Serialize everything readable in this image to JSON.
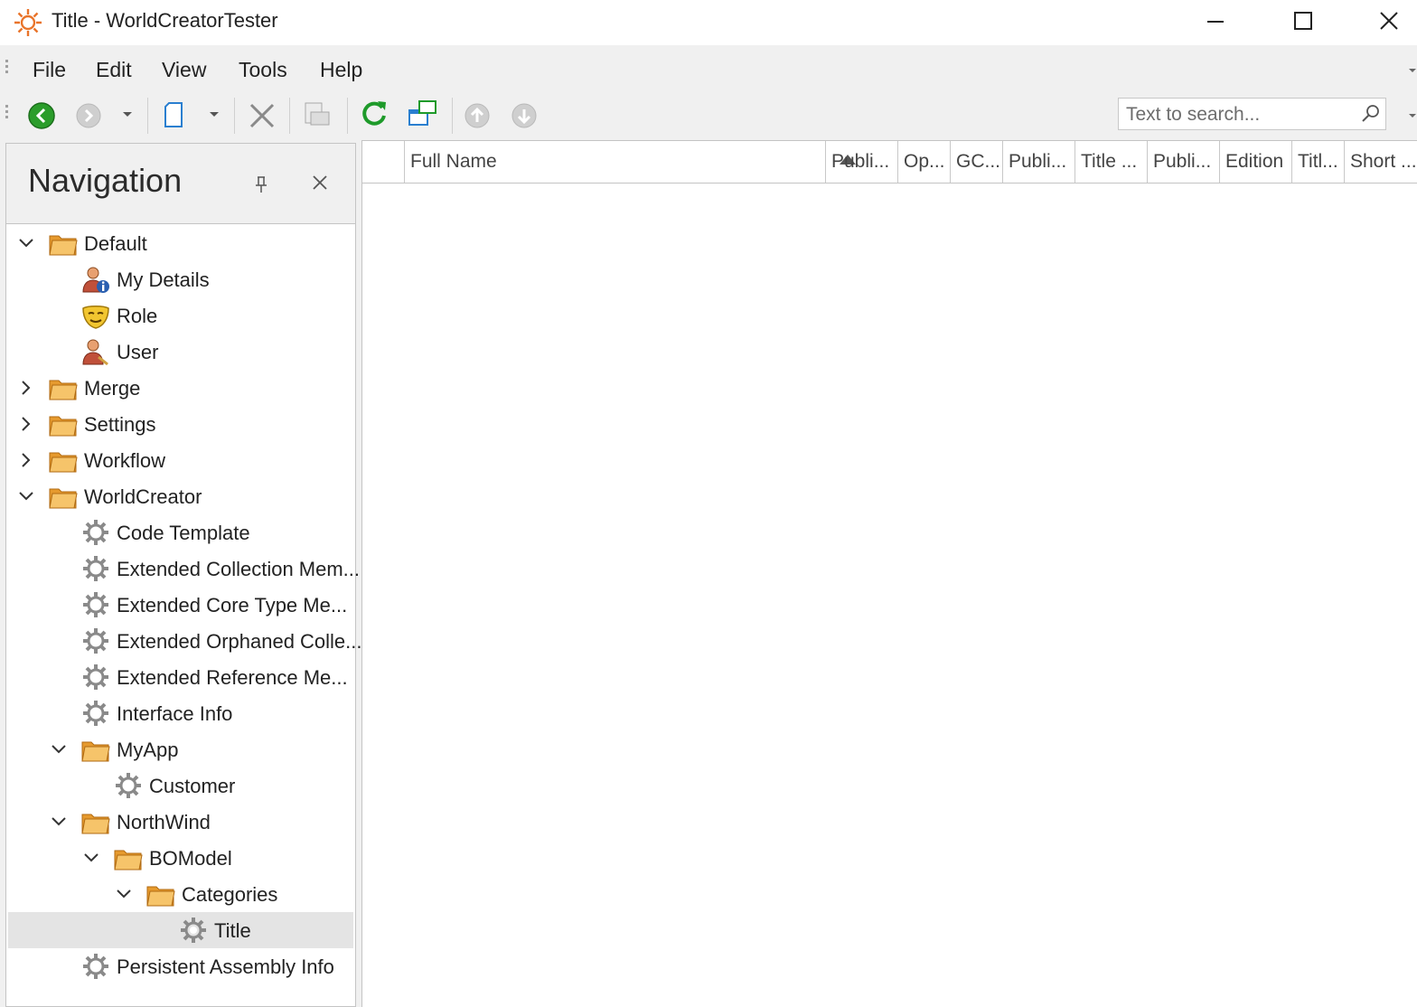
{
  "window": {
    "title": "Title - WorldCreatorTester"
  },
  "menu": [
    "File",
    "Edit",
    "View",
    "Tools",
    "Help"
  ],
  "search": {
    "placeholder": "Text to search..."
  },
  "navigation": {
    "title": "Navigation",
    "items": [
      {
        "label": "Default",
        "icon": "folder-icon",
        "expander": "expanded"
      },
      {
        "label": "My Details",
        "icon": "user-info-icon",
        "expander": "none"
      },
      {
        "label": "Role",
        "icon": "role-mask-icon",
        "expander": "none"
      },
      {
        "label": "User",
        "icon": "user-icon",
        "expander": "none"
      },
      {
        "label": "Merge",
        "icon": "folder-icon",
        "expander": "collapsed"
      },
      {
        "label": "Settings",
        "icon": "folder-icon",
        "expander": "collapsed"
      },
      {
        "label": "Workflow",
        "icon": "folder-icon",
        "expander": "collapsed"
      },
      {
        "label": "WorldCreator",
        "icon": "folder-icon",
        "expander": "expanded"
      },
      {
        "label": "Code Template",
        "icon": "gear-icon",
        "expander": "none"
      },
      {
        "label": "Extended Collection Mem...",
        "icon": "gear-icon",
        "expander": "none"
      },
      {
        "label": "Extended Core Type Me...",
        "icon": "gear-icon",
        "expander": "none"
      },
      {
        "label": "Extended Orphaned Colle...",
        "icon": "gear-icon",
        "expander": "none"
      },
      {
        "label": "Extended Reference Me...",
        "icon": "gear-icon",
        "expander": "none"
      },
      {
        "label": "Interface Info",
        "icon": "gear-icon",
        "expander": "none"
      },
      {
        "label": "MyApp",
        "icon": "folder-icon",
        "expander": "expanded"
      },
      {
        "label": "Customer",
        "icon": "gear-icon",
        "expander": "none"
      },
      {
        "label": "NorthWind",
        "icon": "folder-icon",
        "expander": "expanded"
      },
      {
        "label": "BOModel",
        "icon": "folder-icon",
        "expander": "expanded"
      },
      {
        "label": "Categories",
        "icon": "folder-icon",
        "expander": "expanded"
      },
      {
        "label": "Title",
        "icon": "gear-icon",
        "expander": "none",
        "selected": true
      },
      {
        "label": "Persistent Assembly Info",
        "icon": "gear-icon",
        "expander": "none"
      }
    ]
  },
  "grid": {
    "columns": [
      "Full Name",
      "Publi...",
      "Op...",
      "GC...",
      "Publi...",
      "Title ...",
      "Publi...",
      "Edition",
      "Titl...",
      "Short ..."
    ],
    "sorted_column": "Full Name",
    "sort_direction": "ascending"
  },
  "colors": {
    "folder": "#f0b65a",
    "refresh": "#1e9a2a",
    "back": "#2b9d2b",
    "selection": "#e4e4e4"
  }
}
